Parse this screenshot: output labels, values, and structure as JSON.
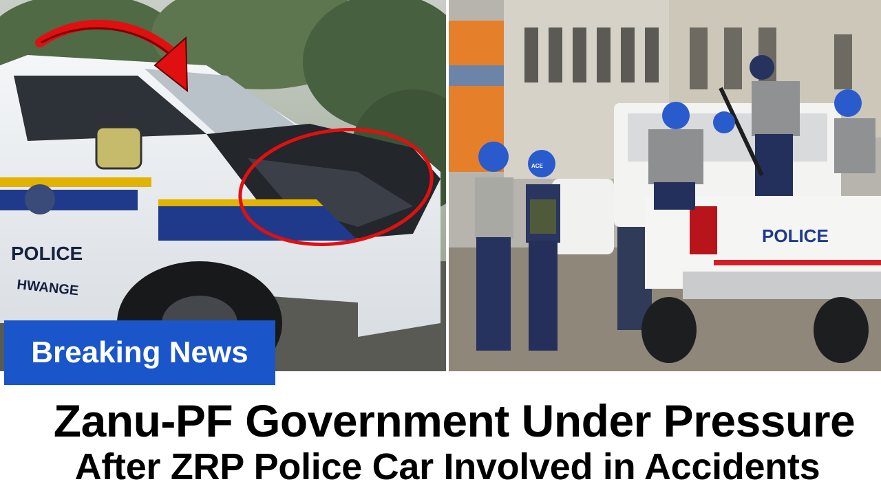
{
  "left_photo": {
    "car_label": "POLICE",
    "car_sublabel": "HWANGE"
  },
  "right_photo": {
    "truck_label": "POLICE",
    "vest_text": "ACE"
  },
  "badge": {
    "label": "Breaking News",
    "color": "#1a56c9"
  },
  "headline": {
    "line1": "Zanu-PF Government Under Pressure",
    "line2": "After ZRP Police Car Involved in Accidents"
  },
  "annotations": {
    "arrow_color": "#e01010",
    "circle_color": "#e01010"
  }
}
